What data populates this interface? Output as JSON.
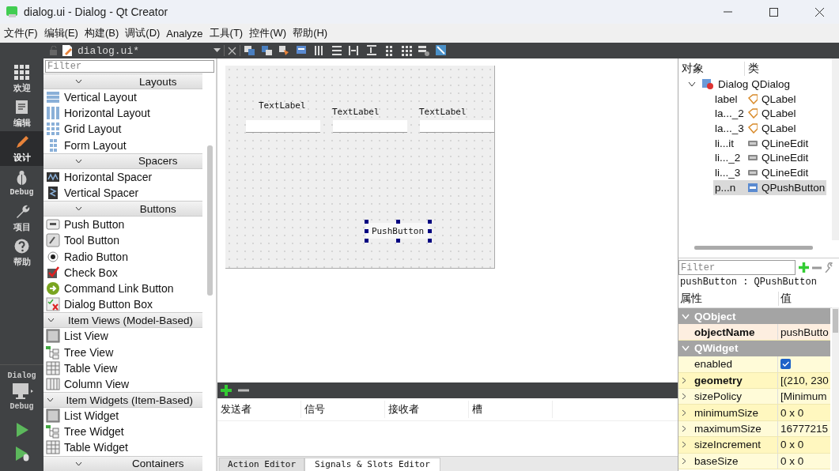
{
  "window": {
    "title": "dialog.ui - Dialog - Qt Creator"
  },
  "menu": [
    {
      "label": "文件(F)"
    },
    {
      "label": "编辑(E)"
    },
    {
      "label": "构建(B)"
    },
    {
      "label": "调试(D)"
    },
    {
      "label": "Analyze"
    },
    {
      "label": "工具(T)"
    },
    {
      "label": "控件(W)"
    },
    {
      "label": "帮助(H)"
    }
  ],
  "editor_toolbar": {
    "file": "dialog.ui*"
  },
  "modes": [
    {
      "label": "欢迎",
      "selected": false
    },
    {
      "label": "编辑",
      "selected": false
    },
    {
      "label": "设计",
      "selected": true
    },
    {
      "label": "Debug",
      "selected": false
    },
    {
      "label": "项目",
      "selected": false
    },
    {
      "label": "帮助",
      "selected": false
    }
  ],
  "kit": {
    "project": "Dialog",
    "config": "Debug"
  },
  "widget_box": {
    "placeholder": "Filter",
    "categories": [
      {
        "title": "Layouts",
        "expanded": true,
        "items": [
          "Vertical Layout",
          "Horizontal Layout",
          "Grid Layout",
          "Form Layout"
        ]
      },
      {
        "title": "Spacers",
        "expanded": true,
        "items": [
          "Horizontal Spacer",
          "Vertical Spacer"
        ]
      },
      {
        "title": "Buttons",
        "expanded": true,
        "items": [
          "Push Button",
          "Tool Button",
          "Radio Button",
          "Check Box",
          "Command Link Button",
          "Dialog Button Box"
        ]
      },
      {
        "title": "Item Views (Model-Based)",
        "expanded": true,
        "items": [
          "List View",
          "Tree View",
          "Table View",
          "Column View"
        ]
      },
      {
        "title": "Item Widgets (Item-Based)",
        "expanded": true,
        "items": [
          "List Widget",
          "Tree Widget",
          "Table Widget"
        ]
      },
      {
        "title": "Containers",
        "expanded": true
      }
    ]
  },
  "form": {
    "labels": [
      "TextLabel",
      "TextLabel",
      "TextLabel"
    ],
    "button": {
      "label": "PushButton",
      "selected": true
    }
  },
  "signals_editor": {
    "columns": [
      "发送者",
      "信号",
      "接收者",
      "槽"
    ],
    "tabs": [
      {
        "label": "Action Editor",
        "selected": false
      },
      {
        "label": "Signals & Slots Editor",
        "selected": true
      }
    ]
  },
  "object_inspector": {
    "columns": [
      "对象",
      "类"
    ],
    "tree": [
      {
        "name": "Dialog",
        "class": "QDialog",
        "expanded": true,
        "selected": false,
        "children": [
          {
            "name": "label",
            "class": "QLabel",
            "selected": false
          },
          {
            "name": "la..._2",
            "class": "QLabel",
            "selected": false
          },
          {
            "name": "la..._3",
            "class": "QLabel",
            "selected": false
          },
          {
            "name": "li...it",
            "class": "QLineEdit",
            "selected": false
          },
          {
            "name": "li..._2",
            "class": "QLineEdit",
            "selected": false
          },
          {
            "name": "li..._3",
            "class": "QLineEdit",
            "selected": false
          },
          {
            "name": "p...n",
            "class": "QPushButton",
            "selected": true
          }
        ]
      }
    ]
  },
  "property_editor": {
    "placeholder": "Filter",
    "caption": "pushButton : QPushButton",
    "columns": [
      "属性",
      "值"
    ],
    "groups": [
      {
        "name": "QObject",
        "expanded": true,
        "properties": [
          {
            "name": "objectName",
            "value": "pushButto",
            "kind": "text",
            "modified": true,
            "expandable": false
          }
        ]
      },
      {
        "name": "QWidget",
        "expanded": true,
        "properties": [
          {
            "name": "enabled",
            "kind": "checkbox",
            "checked": true,
            "modified": false,
            "expandable": false
          },
          {
            "name": "geometry",
            "value": "[(210, 230",
            "kind": "text",
            "modified": true,
            "expandable": true
          },
          {
            "name": "sizePolicy",
            "value": "[Minimum",
            "kind": "text",
            "modified": false,
            "expandable": true
          },
          {
            "name": "minimumSize",
            "value": "0 x 0",
            "kind": "text",
            "modified": false,
            "expandable": true
          },
          {
            "name": "maximumSize",
            "value": "16777215",
            "kind": "text",
            "modified": false,
            "expandable": true
          },
          {
            "name": "sizeIncrement",
            "value": "0 x 0",
            "kind": "text",
            "modified": false,
            "expandable": true
          },
          {
            "name": "baseSize",
            "value": "0 x 0",
            "kind": "text",
            "modified": false,
            "expandable": true
          }
        ]
      }
    ]
  }
}
